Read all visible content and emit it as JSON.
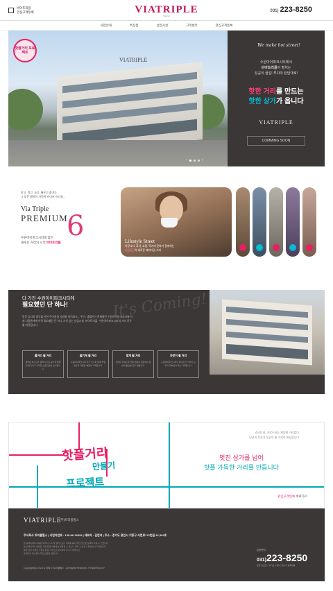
{
  "header": {
    "login_line1": "비아트리플",
    "login_line2": "관심고객등록",
    "logo": "VIATRIPLE",
    "logo_sub": "Suwon",
    "phone_prefix": "031)",
    "phone": "223-8250"
  },
  "nav": [
    "사업안내",
    "특장점",
    "상업시설",
    "고객센터",
    "관심고객등록"
  ],
  "hero": {
    "badge": "핫플거리 프로젝트",
    "script": "We make hot street!",
    "line1": "수원아이파크시티에서",
    "line2_strong": "비아트리플",
    "line2_rest": "이 펼치는",
    "line3": "성공의 꿈길! 투자의 탄탄대로!",
    "headline1_pink": "핫한 거리",
    "headline1_rest": "를 만드는",
    "headline2_cyan": "핫한 상가",
    "headline2_rest": "가 옵니다",
    "brand": "VIATRIPLE",
    "button": "COMMING SOON",
    "sign": "VIATRIPLE"
  },
  "premium": {
    "small1": "보고, 먹고, 사고, 배우고 즐기는",
    "small2": "그 모든 행복이 가득한 라이프 스타일...",
    "via": "Via Triple",
    "premium": "PREMIUM",
    "six": "6",
    "desc1": "수원아이파크시티에 없던",
    "desc2_rest": "새로운 거리의 시작",
    "desc2_pink": "비아트리플",
    "card_title": "Lifestyle Street",
    "card_sub1": "커뮤니티, 휴식, 쇼핑, 먹거리 문화가 함께하는",
    "card_sub2_pink": "상업공간",
    "card_sub2_rest": "의 새로운 패러다임 거리"
  },
  "coming": {
    "kicker": "다 가진 수원아이파크시티에",
    "title": "필요했던 단 하나!",
    "ghost": "It's Coming!",
    "para": "명문 입지와 생각할 만한 주거환경 사람들 아이파크... 주거, 생활만이 존재했던 수원아이파크시티에 이제 사람들에게 아직 필요했던 단 하나 가치 있는 상업시설, 비아트리플. 수원아이파크시티의 거리 모두를 마련합니다.",
    "boxes": [
      {
        "title": "볼거리 될 거리",
        "body": "세련된 파사드와 갤러리 같은 공간과 특별한 볼거리가 가득한 스트리트를 선사합니다."
      },
      {
        "title": "즐기게 될 거리",
        "body": "수원아이파크시티 주거 인구와 함께 즐길 공간과 다양한 체험이 가득합니다."
      },
      {
        "title": "찾게 될 거리",
        "body": "선택된 브랜드와 전문 매장이 입점하여 일상의 필요를 모두 채웁니다."
      },
      {
        "title": "자랑이 될 거리",
        "body": "수원아이파크시티의 랜드마크가 되어 모두의 자부심이 되는 거리입니다."
      }
    ]
  },
  "project": {
    "title1": "핫플거리",
    "title2": "만들기",
    "title3": "프로젝트",
    "small1": "경리단길, 가로수길도 처음엔 거리였다",
    "small2": "당신의 투자가 성공이 될 가치로 완성됩니다",
    "headline1": "멋진 상가를 넘어",
    "headline2": "핫플 가득한 거리를 만듭니다",
    "link_pink": "관심고객등록",
    "link_rest": " 바로가기"
  },
  "footer": {
    "logo": "VIATRIPLE",
    "company": "(주)트리플힐스",
    "info": "주식회사 트리플힐스  |  사업자번호 : 135-86-19532  |  대표자 : 김현석  |  주소 : 경기도 용인시 기흥구 서천로172번길 42,302호",
    "disc1": "본 홈페이지에 사용된 이미지, CG 및 일러스트는 이해를 돕기 위한 것으로 실제와 다를 수 있습니다.",
    "disc2": "본 홈페이지의 내용은 사업 진행 과정에서 변경될 수 있으니 계약 시 반드시 확인하시기 바랍니다.",
    "disc3": "분양 관련 자세한 사항은 분양 사무소로 문의하여 주시기 바랍니다.",
    "disc4": "홈페이지 게시물의 무단 도용을 금합니다.",
    "copy": "Copyright(c) 2023 주식회사 트리플힐스. All Rights Reserved. POWERED BY",
    "phone_label": "분양문의",
    "phone_prefix": "031)",
    "phone": "223-8250",
    "addr": "분양 홍보관 : 경기도 수원시 권선구 호매실동"
  }
}
